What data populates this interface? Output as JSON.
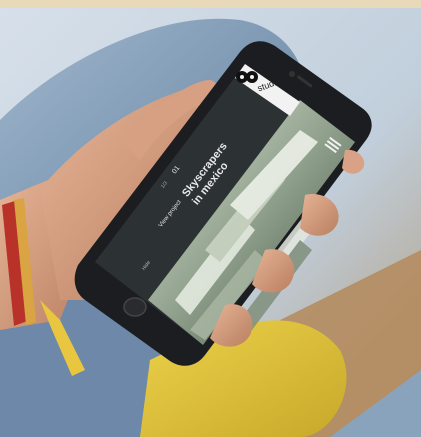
{
  "screen": {
    "logo_text": "studio",
    "project_number": "01",
    "project_title_line1": "Skyscrapers",
    "project_title_line2": "in mexico",
    "project_index": "1/3",
    "cta_label": "View project",
    "footer_label": "Hide"
  },
  "colors": {
    "screen_panel": "#2c3134",
    "phone_body": "#1c1d20",
    "sleeve_denim": "#7f9ab6",
    "skin": "#d49a7c",
    "yellow_pants": "#e0c63a"
  },
  "icons": [
    "hamburger-menu-icon",
    "logo-icon"
  ]
}
